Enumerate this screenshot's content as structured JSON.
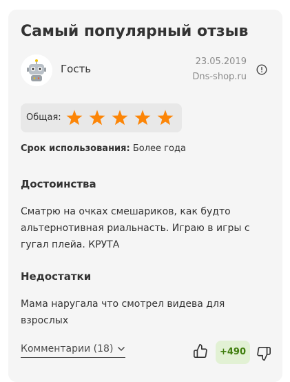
{
  "review": {
    "title": "Самый популярный отзыв",
    "author": "Гость",
    "date": "23.05.2019",
    "source": "Dns-shop.ru",
    "rating_label": "Общая:",
    "rating": 5,
    "rating_max": 5,
    "star_color": "#fc8507",
    "term_label": "Срок использования:",
    "term_value": "Более года",
    "pros_title": "Достоинства",
    "pros_text": "Сматрю на очках смешариков, как будто альтернотивная риальнасть. Играю в игры с гугал плейа. КРУТА",
    "cons_title": "Недостатки",
    "cons_text": "Мама наругала что смотрел видева для взрослых",
    "comments_label": "Комментарии (18)",
    "votes": "+490"
  },
  "icons": {
    "avatar": "robot-icon",
    "info": "info-icon",
    "like": "thumbs-up-icon",
    "dislike": "thumbs-down-icon",
    "expand": "chevron-down-icon"
  }
}
